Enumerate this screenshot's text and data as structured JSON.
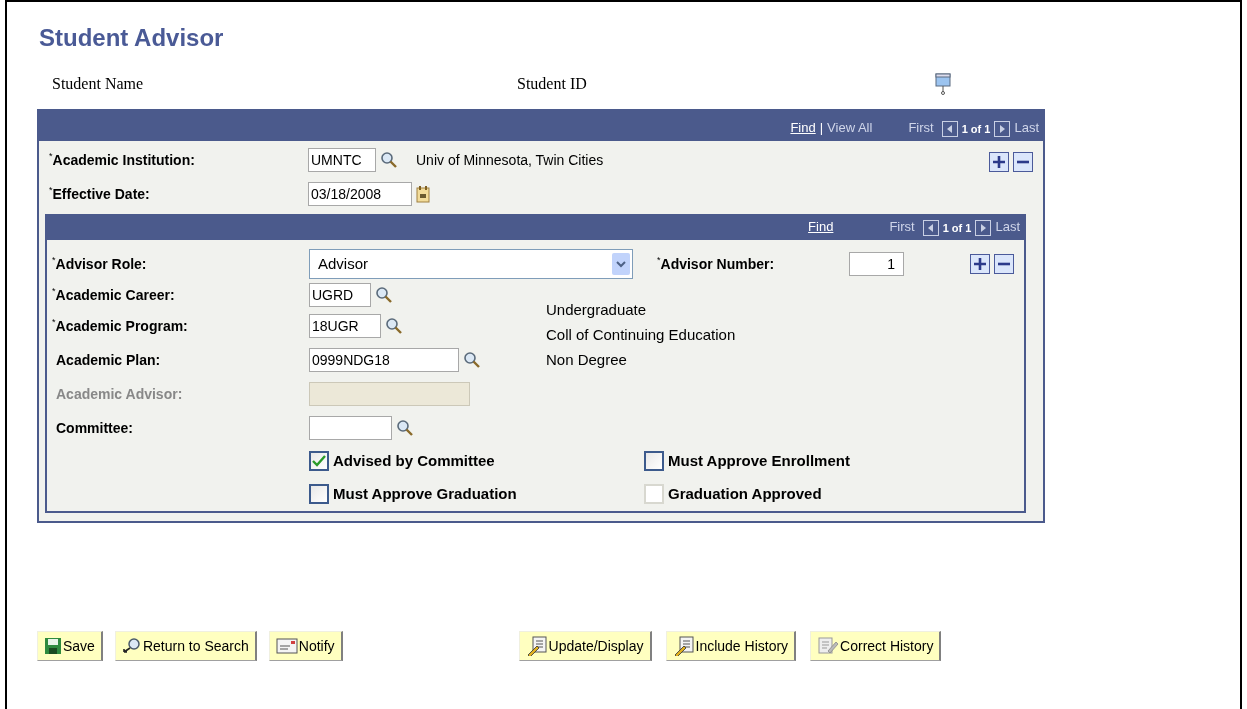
{
  "page_title": "Student Advisor",
  "required_mark": "*",
  "student": {
    "name_label": "Student Name",
    "id_label": "Student ID"
  },
  "outer_grid": {
    "find": "Find",
    "separator": "|",
    "view_all": "View All",
    "first": "First",
    "count": "1 of 1",
    "last": "Last",
    "fields": [
      {
        "label": "Academic Institution:",
        "required": true,
        "value": "UMNTC",
        "kind": "lookup",
        "description": "Univ of Minnesota, Twin Cities"
      },
      {
        "label": "Effective Date:",
        "required": true,
        "value": "03/18/2008",
        "kind": "date"
      }
    ]
  },
  "inner_grid": {
    "find": "Find",
    "first": "First",
    "count": "1 of 1",
    "last": "Last",
    "role": {
      "label": "Advisor Role:",
      "required": true,
      "value": "Advisor"
    },
    "number": {
      "label": "Advisor Number:",
      "required": true,
      "value": "1"
    },
    "fields": [
      {
        "label": "Academic Career:",
        "required": true,
        "value": "UGRD",
        "disabled": false,
        "lookup": true
      },
      {
        "label": "Academic Program:",
        "required": true,
        "value": "18UGR",
        "disabled": false,
        "lookup": true
      },
      {
        "label": "Academic Plan:",
        "required": false,
        "value": "0999NDG18",
        "disabled": false,
        "lookup": true
      },
      {
        "label": "Academic Advisor:",
        "required": false,
        "disabled": true,
        "lookup": false
      },
      {
        "label": "Committee:",
        "required": false,
        "disabled": false,
        "lookup": true
      }
    ],
    "descriptions": [
      "Undergraduate",
      "Coll of Continuing Education",
      "Non Degree"
    ],
    "checkboxes": [
      {
        "label": "Advised by Committee",
        "checked": true,
        "disabled": false
      },
      {
        "label": "Must Approve Enrollment",
        "checked": false,
        "disabled": false
      },
      {
        "label": "Must Approve Graduation",
        "checked": false,
        "disabled": false
      },
      {
        "label": "Graduation Approved",
        "checked": false,
        "disabled": true
      }
    ]
  },
  "buttons_left": [
    {
      "label": "Save",
      "kind": "save"
    },
    {
      "label": "Return to Search",
      "kind": "search"
    },
    {
      "label": "Notify",
      "kind": "notify"
    }
  ],
  "buttons_right": [
    {
      "label": "Update/Display",
      "kind": "update"
    },
    {
      "label": "Include History",
      "kind": "update"
    },
    {
      "label": "Correct History",
      "kind": "correct"
    }
  ]
}
